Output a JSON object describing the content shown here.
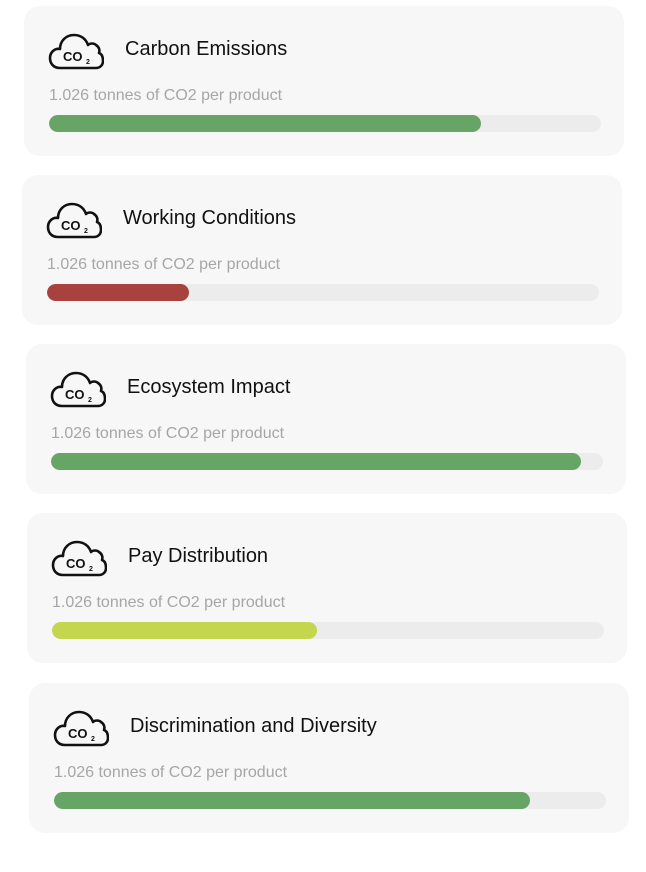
{
  "metrics": [
    {
      "title": "Carbon Emissions",
      "subtitle": "1.026 tonnes of CO2 per product",
      "level": 0.783,
      "color": "#66a565",
      "icon": "co2-cloud-icon"
    },
    {
      "title": "Working Conditions",
      "subtitle": "1.026 tonnes of CO2 per product",
      "level": 0.257,
      "color": "#a7423f",
      "icon": "co2-cloud-icon"
    },
    {
      "title": "Ecosystem Impact",
      "subtitle": "1.026 tonnes of CO2 per product",
      "level": 0.96,
      "color": "#66a565",
      "icon": "co2-cloud-icon"
    },
    {
      "title": "Pay Distribution",
      "subtitle": "1.026 tonnes of CO2 per product",
      "level": 0.48,
      "color": "#c4d54e",
      "icon": "co2-cloud-icon"
    },
    {
      "title": "Discrimination and Diversity",
      "subtitle": "1.026 tonnes of CO2 per product",
      "level": 0.862,
      "color": "#66a565",
      "icon": "co2-cloud-icon"
    }
  ],
  "icon_text": {
    "co": "CO",
    "sub": "2"
  }
}
